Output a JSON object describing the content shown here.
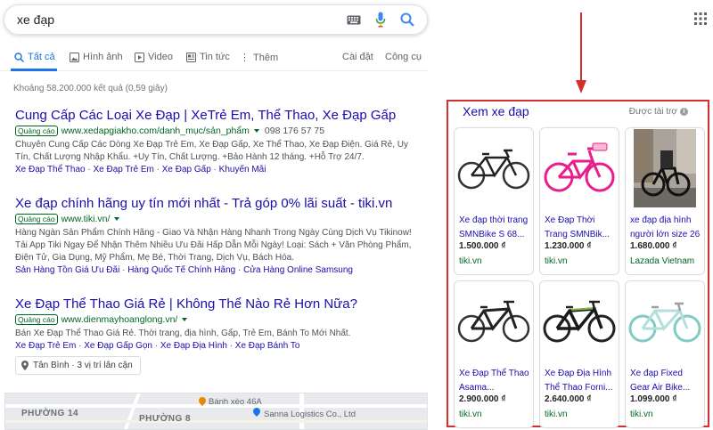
{
  "search": {
    "query": "xe đạp"
  },
  "tabs": [
    {
      "label": "Tất cả",
      "icon": "search-icon",
      "active": true
    },
    {
      "label": "Hình ảnh",
      "icon": "image-icon"
    },
    {
      "label": "Video",
      "icon": "video-icon"
    },
    {
      "label": "Tin tức",
      "icon": "news-icon"
    },
    {
      "label": "Thêm",
      "icon": "more-icon"
    }
  ],
  "tools": {
    "settings": "Cài đặt",
    "tools": "Công cụ"
  },
  "stats": "Khoảng 58.200.000 kết quả (0,59 giây)",
  "ad_badge": "Quảng cáo",
  "results": [
    {
      "title": "Cung Cấp Các Loại Xe Đạp | XeTrẻ Em, Thể Thao, Xe Đạp Gấp",
      "url": "www.xedapgiakho.com/danh_mục/sản_phẩm",
      "phone": "098 176 57 75",
      "desc1": "Chuyên Cung Cấp Các Dòng Xe Đạp Trẻ Em, Xe Đạp Gấp, Xe Thể Thao, Xe Đạp Điện. Giá Rẻ, Uy",
      "desc2": "Tín, Chất Lượng Nhập Khẩu. +Uy Tín, Chất Lượng. +Bảo Hành 12 tháng. +Hỗ Trợ 24/7.",
      "links": [
        "Xe Đạp Thể Thao",
        "Xe Đạp Trẻ Em",
        "Xe Đạp Gấp",
        "Khuyến Mãi"
      ]
    },
    {
      "title": "Xe đạp chính hãng uy tín mới nhất - Trả góp 0% lãi suất - tiki.vn",
      "url": "www.tiki.vn/",
      "desc1": "Hàng Ngàn Sản Phẩm Chính Hãng - Giao Và Nhận Hàng Nhanh Trong Ngày Cùng Dịch Vụ Tikinow!",
      "desc2": "Tải App Tiki Ngay Để Nhận Thêm Nhiều Ưu Đãi Hấp Dẫn Mỗi Ngày! Loại: Sách + Văn Phòng Phẩm,",
      "desc3": "Điện Tử, Gia Dụng, Mỹ Phẩm, Mẹ Bé, Thời Trang, Dịch Vụ, Bách Hóa.",
      "links": [
        "Sản Hàng Tồn Giá Ưu Đãi",
        "Hàng Quốc Tế Chính Hãng",
        "Cửa Hàng Online Samsung"
      ]
    },
    {
      "title": "Xe Đạp Thể Thao Giá Rẻ | Không Thể Nào Rẻ Hơn Nữa?",
      "url": "www.dienmayhoanglong.vn/",
      "desc1": "Bán Xe Đạp Thể Thao Giá Rẻ. Thời trang, địa hình, Gấp, Trẻ Em, Bánh To Mới Nhất.",
      "links": [
        "Xe Đạp Trẻ Em",
        "Xe Đạp Gấp Gọn",
        "Xe Đạp Địa Hình",
        "Xe Đạp Bánh To"
      ]
    }
  ],
  "location_chip": "Tân Bình · 3 vị trí lân cận",
  "map": {
    "labels": [
      "PHƯỜNG 14",
      "PHƯỜNG 8"
    ],
    "pois": [
      "Bánh xèo 46A",
      "Sanna Logistics Co., Ltd"
    ]
  },
  "shopping": {
    "title": "Xem xe đạp",
    "sponsored": "Được tài trợ",
    "products": [
      {
        "name": "Xe đạp thời trang SMNBike S 68...",
        "price": "1.500.000 ₫",
        "store": "tiki.vn",
        "image": "black-city-bike"
      },
      {
        "name": "Xe Đạp Thời Trang SMNBik...",
        "price": "1.230.000 ₫",
        "store": "tiki.vn",
        "image": "pink-kids-bike"
      },
      {
        "name": "xe đạp địa hình người lớn size 26",
        "price": "1.680.000 ₫",
        "store": "Lazada Vietnam",
        "image": "mtb-photo"
      },
      {
        "name": "Xe Đạp Thể Thao Asama...",
        "price": "2.900.000 ₫",
        "store": "tiki.vn",
        "image": "black-sport-bike"
      },
      {
        "name": "Xe Đạp Địa Hình Thể Thao Forni...",
        "price": "2.640.000 ₫",
        "store": "tiki.vn",
        "image": "black-green-mtb"
      },
      {
        "name": "Xe đạp Fixed Gear Air Bike...",
        "price": "1.099.000 ₫",
        "store": "tiki.vn",
        "image": "mint-fixed-gear"
      }
    ]
  },
  "colors": {
    "link": "#1a0dab",
    "url": "#006621",
    "accent": "#1a73e8",
    "highlight": "#d32f2f"
  }
}
